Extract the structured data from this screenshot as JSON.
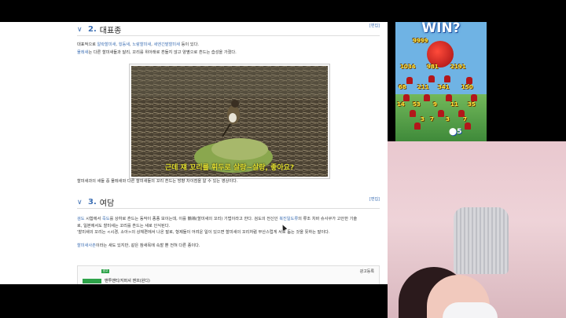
{
  "section2": {
    "number": "2.",
    "title": "대표종",
    "edit": "[편집]"
  },
  "intro_line1": {
    "prefix": "대표적으로 ",
    "links": [
      "알락할미새",
      "힝둥새",
      "노랑할미새",
      "세엔긴밭할미새"
    ],
    "sep": ", ",
    "suffix": " 등이 있다."
  },
  "intro_line2": {
    "link": "물레새",
    "rest": "는 다른 할미새들과 달리, 꼬리를 위아래로 흔들지 않고 양옆으로 흔드는 습성을 가졌다."
  },
  "photo": {
    "caption": "근데 쟤 꼬리를 휘두로 살랑~살랑, 좋아요?"
  },
  "photo_note": "할미새과의 새들 중 물레새와 다른 할미새들의 꼬리 흔드는 방향 차이점을 알 수 있는 영상이다.",
  "section3": {
    "number": "3.",
    "title": "여담",
    "edit": "[편집]"
  },
  "trivia_line1": {
    "link1": "검도",
    "part1": " 시합에서 ",
    "link2": "죽도",
    "part2": "를 상하로 흔드는 동작이 종종 보이는데, 이를 鶺鴒(할미새의 꼬리) 기법이라고 한다. 검도의 전신인 ",
    "link3": "북진일도류",
    "part3": "의 류조 치바 슈사쿠가 고안한 기술"
  },
  "trivia_line2": "로, 일본에서도 할미새는 꼬리를 흔드는 새로 인식된다.",
  "trivia_line3": "'할미새의 꼬리는 <시경, 소아>의 상체편에서 나온 말로, 형제들이 어려운 일이 있으면 할미새의 꼬리처럼 부산스럽게 서로 돕는 것을 뜻하는 말이다.",
  "trivia_line4": {
    "link": "할미새사촌",
    "rest": "이라는 새도 있지만, 같은 참새목에 속할 뿐 전혀 다른 종이다."
  },
  "ad": {
    "label": "광고등록",
    "badge": "광고",
    "text": "맨투맨티/지퍼셔 맨프(원디)"
  },
  "game": {
    "title": "WIN?",
    "top_score": "9999",
    "scores_row1": [
      "1034",
      "981",
      "2191"
    ],
    "scores_row2": [
      "68",
      "211",
      "341",
      "150"
    ],
    "scores_row3": [
      "14",
      "53",
      "9",
      "11",
      "35"
    ],
    "scores_row4": [
      "3",
      "7",
      "3",
      "7"
    ],
    "hero_count": "5",
    "colors": {
      "sky": "#6fb3e4",
      "score": "#ffe23a",
      "enemy": "#b3161a"
    }
  },
  "icons": [
    "chevron-down-icon",
    "mouse-cursor-icon"
  ],
  "colors": {
    "link": "#3d6fb4",
    "ad_green": "#2ea34a",
    "caption_yellow": "#e4e030"
  }
}
